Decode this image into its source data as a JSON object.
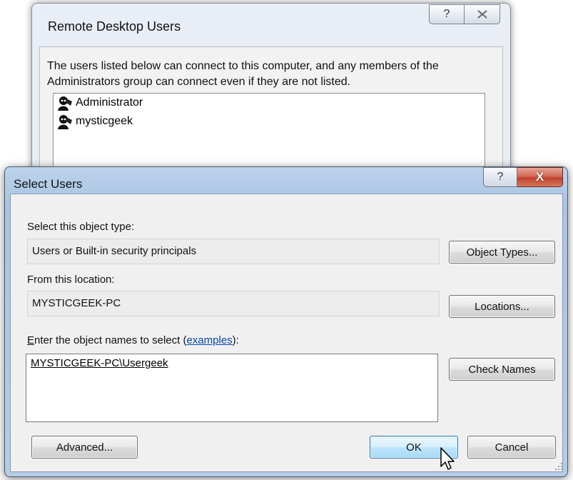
{
  "remote_desktop_users": {
    "title": "Remote Desktop Users",
    "help_icon": "question-mark-icon",
    "close_icon": "close-x-icon",
    "description": "The users listed below can connect to this computer, and any members of the Administrators group can connect even if they are not listed.",
    "users": [
      {
        "name": "Administrator",
        "icon": "user-icon"
      },
      {
        "name": "mysticgeek",
        "icon": "user-icon"
      }
    ]
  },
  "select_users": {
    "title": "Select Users",
    "help_glyph": "?",
    "close_glyph": "X",
    "object_type_label": "Select this object type:",
    "object_type_value": "Users or Built-in security principals",
    "object_types_button": "Object Types...",
    "location_label": "From this location:",
    "location_value": "MYSTICGEEK-PC",
    "locations_button": "Locations...",
    "enter_names_label_prefix": "nter the object names to select (",
    "enter_names_accel": "E",
    "examples_link": "examples",
    "enter_names_label_suffix": "):",
    "names_value": "MYSTICGEEK-PC\\Usergeek",
    "check_names_button": "Check Names",
    "advanced_button": "Advanced...",
    "ok_button": "OK",
    "cancel_button": "Cancel"
  }
}
